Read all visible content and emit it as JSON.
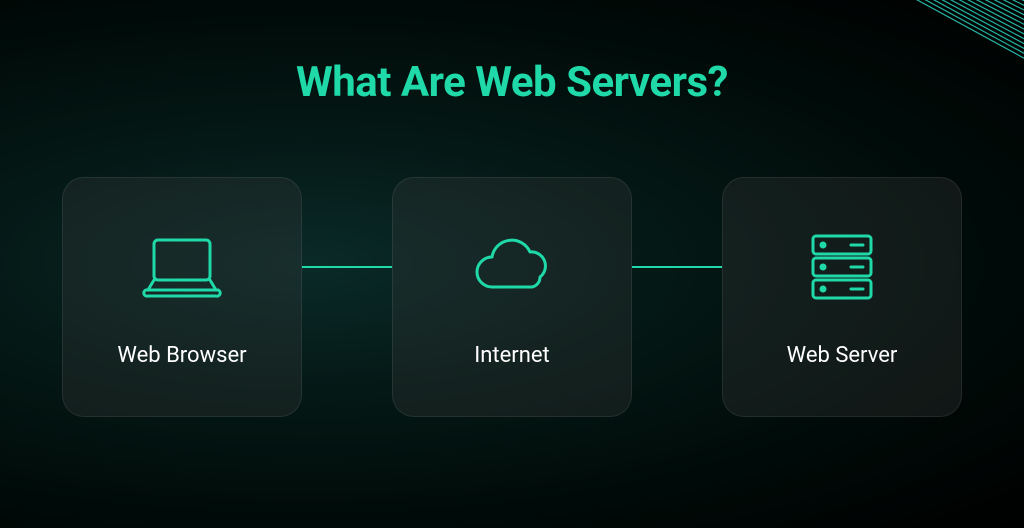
{
  "title": "What Are Web Servers?",
  "cards": [
    {
      "label": "Web Browser",
      "icon": "laptop"
    },
    {
      "label": "Internet",
      "icon": "cloud"
    },
    {
      "label": "Web Server",
      "icon": "server"
    }
  ],
  "accent_color": "#1fd9a8"
}
